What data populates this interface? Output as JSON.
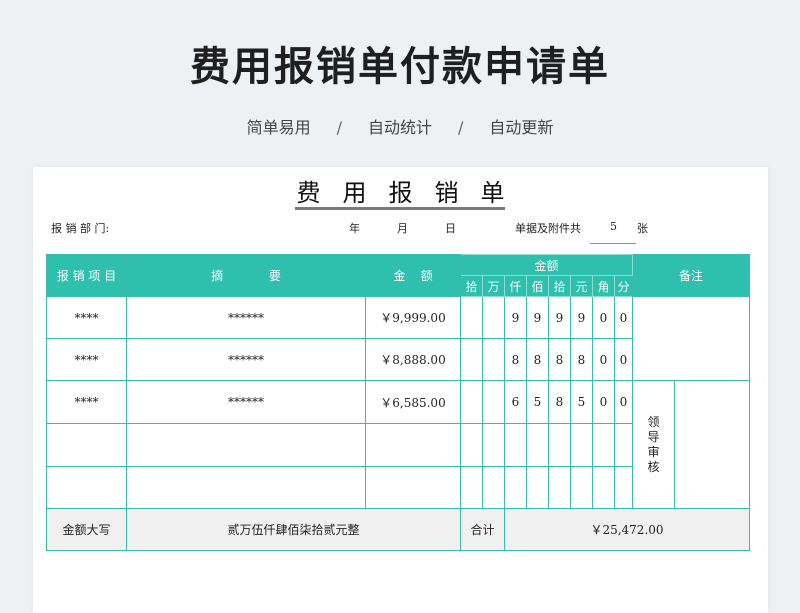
{
  "hero": {
    "title": "费用报销单付款申请单",
    "tags": [
      "简单易用",
      "自动统计",
      "自动更新"
    ],
    "separator": "/"
  },
  "doc": {
    "title": "费用报销单",
    "dept_label": "报 销 部 门:",
    "year_label": "年",
    "month_label": "月",
    "day_label": "日",
    "attach_label": "单据及附件共",
    "attach_count": "5",
    "attach_unit": "张"
  },
  "table": {
    "headers": {
      "item": "报 销 项 目",
      "summary": "摘            要",
      "amount": "金    额",
      "amount_group": "金额",
      "digits": [
        "拾",
        "万",
        "仟",
        "佰",
        "拾",
        "元",
        "角",
        "分"
      ],
      "remark": "备注"
    },
    "rows": [
      {
        "item": "****",
        "summary": "******",
        "amount": "￥9,999.00",
        "digits": [
          "",
          "",
          "9",
          "9",
          "9",
          "9",
          "0",
          "0"
        ]
      },
      {
        "item": "****",
        "summary": "******",
        "amount": "￥8,888.00",
        "digits": [
          "",
          "",
          "8",
          "8",
          "8",
          "8",
          "0",
          "0"
        ]
      },
      {
        "item": "****",
        "summary": "******",
        "amount": "￥6,585.00",
        "digits": [
          "",
          "",
          "6",
          "5",
          "8",
          "5",
          "0",
          "0"
        ]
      },
      {
        "item": "",
        "summary": "",
        "amount": "",
        "digits": [
          "",
          "",
          "",
          "",
          "",
          "",
          "",
          ""
        ]
      },
      {
        "item": "",
        "summary": "",
        "amount": "",
        "digits": [
          "",
          "",
          "",
          "",
          "",
          "",
          "",
          ""
        ]
      }
    ],
    "approval_label": "领导审核",
    "total_caps_label": "金额大写",
    "total_caps_value": "贰万伍仟肆佰柒拾贰元整",
    "total_label": "合计",
    "total_value": "￥25,472.00"
  }
}
